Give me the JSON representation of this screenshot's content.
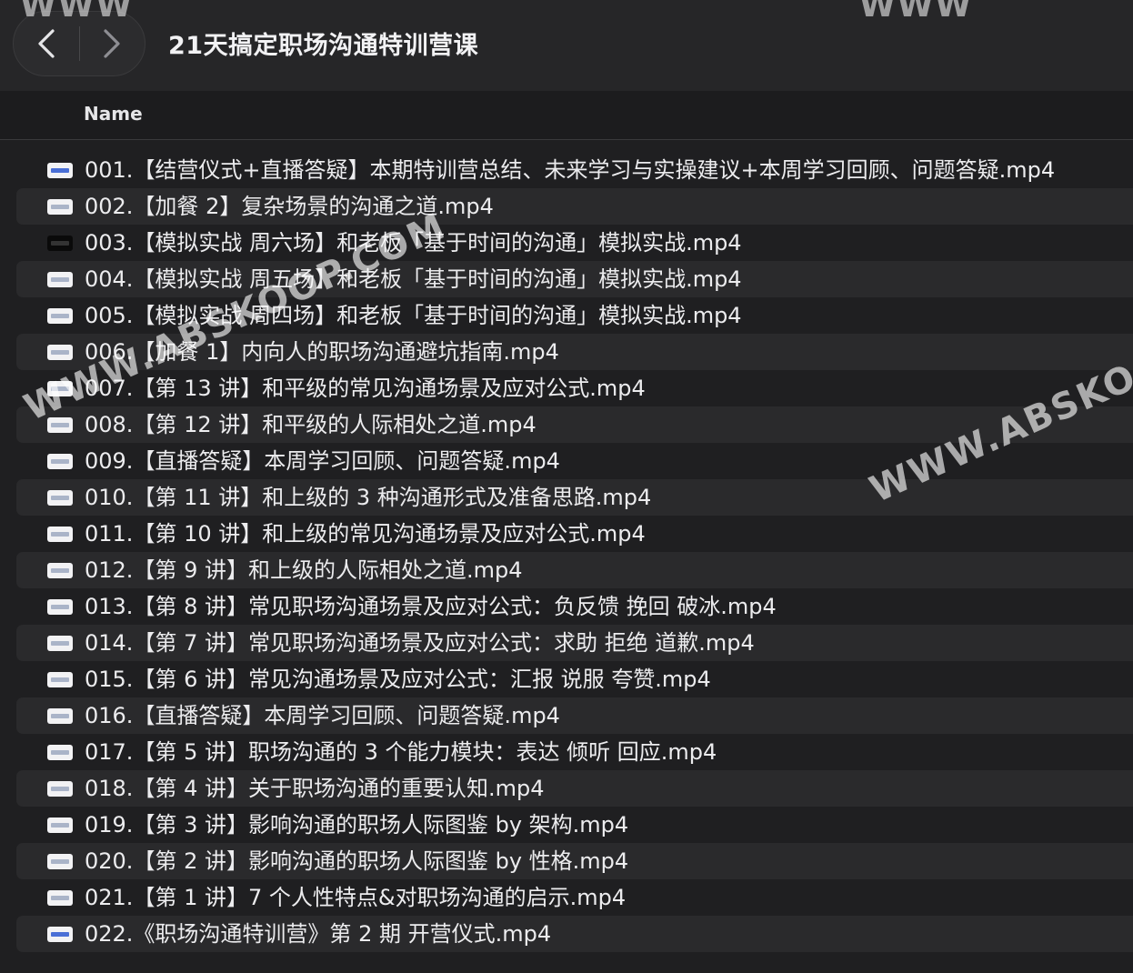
{
  "window": {
    "title": "21天搞定职场沟通特训营课"
  },
  "navigation": {
    "back_icon": "chevron-left-icon",
    "forward_icon": "chevron-right-icon"
  },
  "header": {
    "name_column": "Name"
  },
  "files": [
    {
      "name": "001.【结营仪式+直播答疑】本期特训营总结、未来学习与实操建议+本周学习回顾、问题答疑.mp4",
      "icon": "video-file-icon"
    },
    {
      "name": "002.【加餐 2】复杂场景的沟通之道.mp4",
      "icon": "video-file-icon"
    },
    {
      "name": "003.【模拟实战 周六场】和老板「基于时间的沟通」模拟实战.mp4",
      "icon": "video-file-dark-icon"
    },
    {
      "name": "004.【模拟实战 周五场】和老板「基于时间的沟通」模拟实战.mp4",
      "icon": "video-file-icon"
    },
    {
      "name": "005.【模拟实战 周四场】和老板「基于时间的沟通」模拟实战.mp4",
      "icon": "video-file-icon"
    },
    {
      "name": "006.【加餐 1】内向人的职场沟通避坑指南.mp4",
      "icon": "video-file-icon"
    },
    {
      "name": "007.【第 13 讲】和平级的常见沟通场景及应对公式.mp4",
      "icon": "video-file-icon"
    },
    {
      "name": "008.【第 12 讲】和平级的人际相处之道.mp4",
      "icon": "video-file-icon"
    },
    {
      "name": "009.【直播答疑】本周学习回顾、问题答疑.mp4",
      "icon": "video-file-icon"
    },
    {
      "name": "010.【第 11 讲】和上级的 3 种沟通形式及准备思路.mp4",
      "icon": "video-file-icon"
    },
    {
      "name": "011.【第 10 讲】和上级的常见沟通场景及应对公式.mp4",
      "icon": "video-file-icon"
    },
    {
      "name": "012.【第 9 讲】和上级的人际相处之道.mp4",
      "icon": "video-file-icon"
    },
    {
      "name": "013.【第 8 讲】常见职场沟通场景及应对公式：负反馈 挽回 破冰.mp4",
      "icon": "video-file-icon"
    },
    {
      "name": "014.【第 7 讲】常见职场沟通场景及应对公式：求助 拒绝 道歉.mp4",
      "icon": "video-file-icon"
    },
    {
      "name": "015.【第 6 讲】常见沟通场景及应对公式：汇报 说服 夸赞.mp4",
      "icon": "video-file-icon"
    },
    {
      "name": "016.【直播答疑】本周学习回顾、问题答疑.mp4",
      "icon": "video-file-icon"
    },
    {
      "name": "017.【第 5 讲】职场沟通的 3 个能力模块：表达 倾听 回应.mp4",
      "icon": "video-file-icon"
    },
    {
      "name": "018.【第 4 讲】关于职场沟通的重要认知.mp4",
      "icon": "video-file-icon"
    },
    {
      "name": "019.【第 3 讲】影响沟通的职场人际图鉴 by 架构.mp4",
      "icon": "video-file-icon"
    },
    {
      "name": "020.【第 2 讲】影响沟通的职场人际图鉴 by 性格.mp4",
      "icon": "video-file-icon"
    },
    {
      "name": "021.【第 1 讲】7 个人性特点&对职场沟通的启示.mp4",
      "icon": "video-file-icon"
    },
    {
      "name": "022.《职场沟通特训营》第 2 期 开营仪式.mp4",
      "icon": "video-file-icon"
    }
  ],
  "watermark": {
    "text": "WWW.ABSKOOP.COM",
    "text_short": "WWW",
    "text_right": "WWW.ABSKOOP"
  },
  "colors": {
    "background": "#1f1f21",
    "row_alt": "#2a2a2c",
    "text": "#ececee",
    "icon_blue": "#4a6fd6"
  }
}
